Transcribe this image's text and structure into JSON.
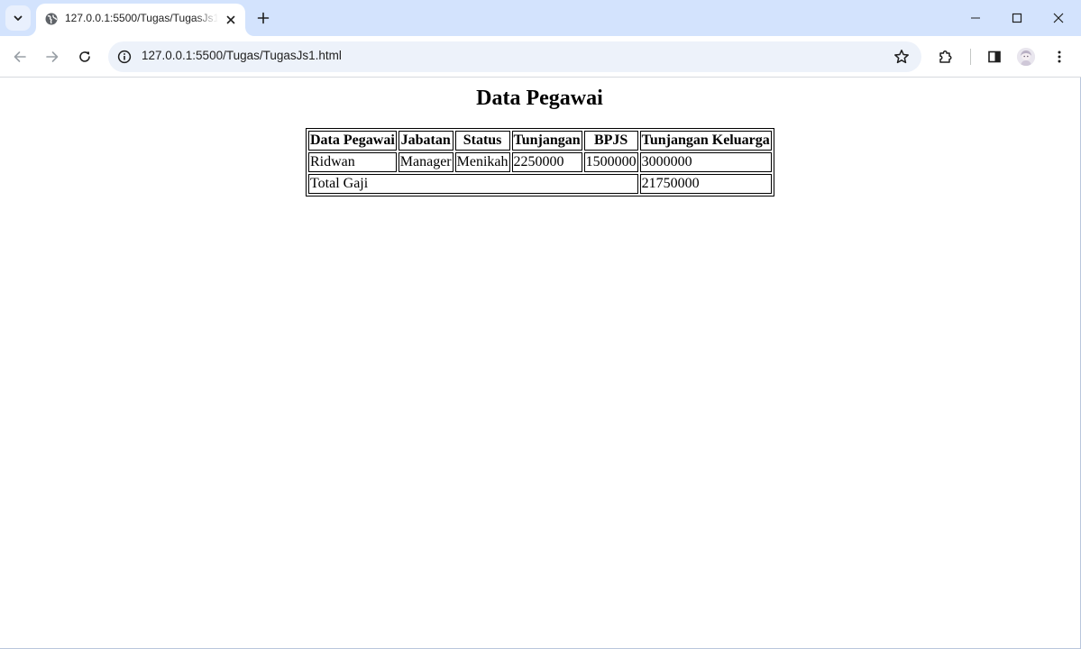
{
  "browser": {
    "tab": {
      "title": "127.0.0.1:5500/Tugas/TugasJs1.html"
    },
    "address_bar": {
      "url": "127.0.0.1:5500/Tugas/TugasJs1.html"
    },
    "icons": {
      "tab_search": "chevron-down-icon",
      "favicon": "globe-icon",
      "tab_close": "close-icon",
      "new_tab": "plus-icon",
      "minimize": "minimize-icon",
      "maximize": "maximize-icon",
      "close_window": "close-icon",
      "back": "arrow-left-icon",
      "forward": "arrow-right-icon",
      "reload": "reload-icon",
      "site_info": "info-icon",
      "bookmark": "star-icon",
      "extensions": "puzzle-icon",
      "side_panel": "side-panel-icon",
      "profile": "avatar",
      "menu": "kebab-menu-icon"
    },
    "colors": {
      "tab_strip": "#d3e3fd",
      "omnibox": "#edf2fa"
    }
  },
  "page": {
    "heading": "Data Pegawai",
    "table": {
      "headers": [
        "Data Pegawai",
        "Jabatan",
        "Status",
        "Tunjangan",
        "BPJS",
        "Tunjangan Keluarga"
      ],
      "rows": [
        [
          "Ridwan",
          "Manager",
          "Menikah",
          "2250000",
          "1500000",
          "3000000"
        ]
      ],
      "total_label": "Total Gaji",
      "total_value": "21750000"
    }
  }
}
